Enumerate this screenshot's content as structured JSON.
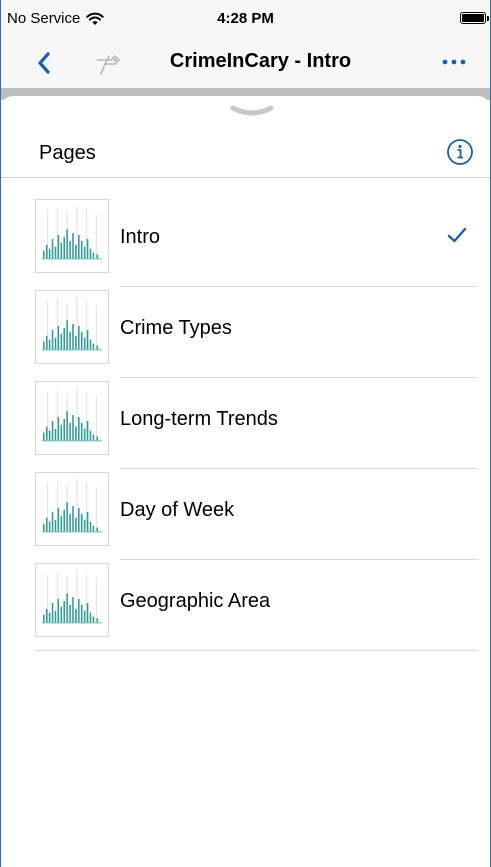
{
  "status_bar": {
    "carrier": "No Service",
    "time": "4:28 PM",
    "battery_level": 1.0
  },
  "nav": {
    "title": "CrimeInCary - Intro",
    "back_icon": "chevron-left-icon",
    "app_icon": "pin-logo-icon",
    "more_icon": "ellipsis-icon"
  },
  "sheet": {
    "title": "Pages",
    "info_icon": "info-circle-icon",
    "grabber_icon": "chevron-down-icon"
  },
  "pages": [
    {
      "label": "Intro",
      "selected": true
    },
    {
      "label": "Crime Types",
      "selected": false
    },
    {
      "label": "Long-term Trends",
      "selected": false
    },
    {
      "label": "Day of Week",
      "selected": false
    },
    {
      "label": "Geographic Area",
      "selected": false
    }
  ],
  "colors": {
    "accent": "#1c5ea8",
    "thumbnail_bars": "#2f9c95",
    "divider": "#d9d9d9"
  }
}
